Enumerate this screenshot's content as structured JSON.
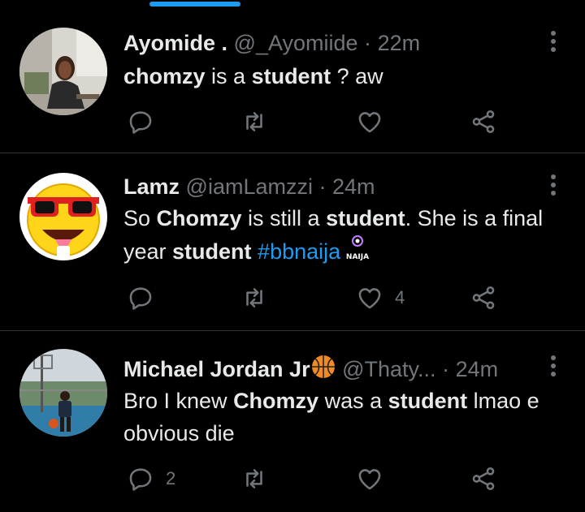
{
  "colors": {
    "accent": "#1d9bf0",
    "muted": "#71767b",
    "text": "#e7e9ea",
    "background": "#000000",
    "divider": "#2f3336"
  },
  "tweets": [
    {
      "name": "Ayomide .",
      "handle": "@_Ayomiide",
      "separator": "·",
      "time": "22m",
      "body": {
        "p1": "chomzy",
        "p2": " is a ",
        "p3": "student",
        "p4": " ? aw"
      },
      "reply_count": "",
      "like_count": ""
    },
    {
      "name": "Lamz",
      "handle": "@iamLamzzi",
      "separator": "·",
      "time": "24m",
      "body": {
        "p1": "So ",
        "p2": "Chomzy",
        "p3": " is still a ",
        "p4": "student",
        "p5": ". She is a final year ",
        "p6": "student",
        "p7": " ",
        "p8": "#bbnaija",
        "emblem_text": "NAIJA"
      },
      "reply_count": "",
      "like_count": "4"
    },
    {
      "name": "Michael Jordan Jr",
      "handle": "@Thaty...",
      "separator": "·",
      "time": "24m",
      "body": {
        "p1": "Bro I knew ",
        "p2": "Chomzy",
        "p3": " was a ",
        "p4": "student",
        "p5": " lmao e obvious die"
      },
      "reply_count": "2",
      "like_count": ""
    }
  ],
  "icons": {
    "reply": "reply-icon",
    "retweet": "retweet-icon",
    "like": "heart-icon",
    "share": "share-icon",
    "more": "more-options-icon"
  }
}
